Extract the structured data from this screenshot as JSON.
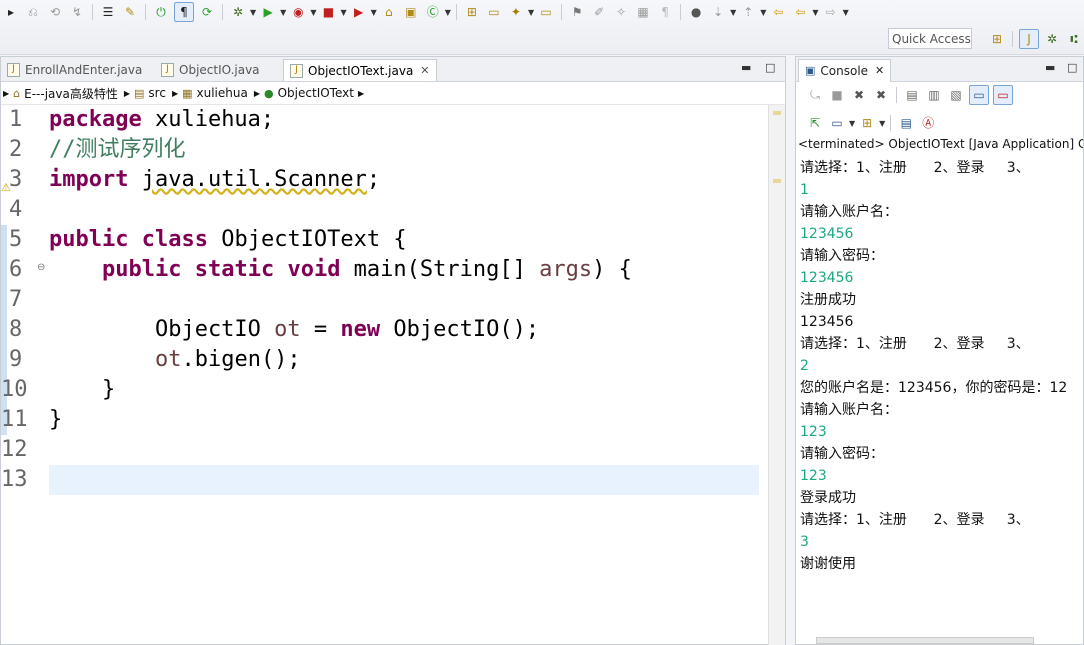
{
  "toolbar": {
    "quick_access": "Quick Access"
  },
  "editor": {
    "tabs": [
      {
        "label": "EnrollAndEnter.java",
        "active": false
      },
      {
        "label": "ObjectIO.java",
        "active": false
      },
      {
        "label": "ObjectIOText.java",
        "active": true
      }
    ],
    "breadcrumb": [
      "E---java高级特性",
      "src",
      "xuliehua",
      "ObjectIOText"
    ],
    "line_numbers": [
      "1",
      "2",
      "3",
      "4",
      "5",
      "6",
      "7",
      "8",
      "9",
      "10",
      "11",
      "12",
      "13"
    ]
  },
  "console": {
    "tab_label": "Console",
    "terminated": "<terminated> ObjectIOText [Java Application] C:\\",
    "lines": [
      {
        "text": "请选择：1、注册      2、登录     3、",
        "type": "out"
      },
      {
        "text": "1",
        "type": "in"
      },
      {
        "text": "请输入账户名：",
        "type": "out"
      },
      {
        "text": "123456",
        "type": "in"
      },
      {
        "text": "请输入密码：",
        "type": "out"
      },
      {
        "text": "123456",
        "type": "in"
      },
      {
        "text": "注册成功",
        "type": "out"
      },
      {
        "text": "123456",
        "type": "out"
      },
      {
        "text": "请选择：1、注册      2、登录     3、",
        "type": "out"
      },
      {
        "text": "2",
        "type": "in"
      },
      {
        "text": "您的账户名是：123456，你的密码是：12",
        "type": "out"
      },
      {
        "text": "请输入账户名：",
        "type": "out"
      },
      {
        "text": "123",
        "type": "in"
      },
      {
        "text": "请输入密码：",
        "type": "out"
      },
      {
        "text": "123",
        "type": "in"
      },
      {
        "text": "登录成功",
        "type": "out"
      },
      {
        "text": "请选择：1、注册      2、登录     3、",
        "type": "out"
      },
      {
        "text": "3",
        "type": "in"
      },
      {
        "text": "谢谢使用",
        "type": "out"
      }
    ]
  },
  "colors": {
    "keyword": "#7f0055",
    "comment": "#3f7f5f",
    "local_var": "#6a3e3e",
    "console_input": "#19a881",
    "current_line": "#e8f2fe"
  }
}
